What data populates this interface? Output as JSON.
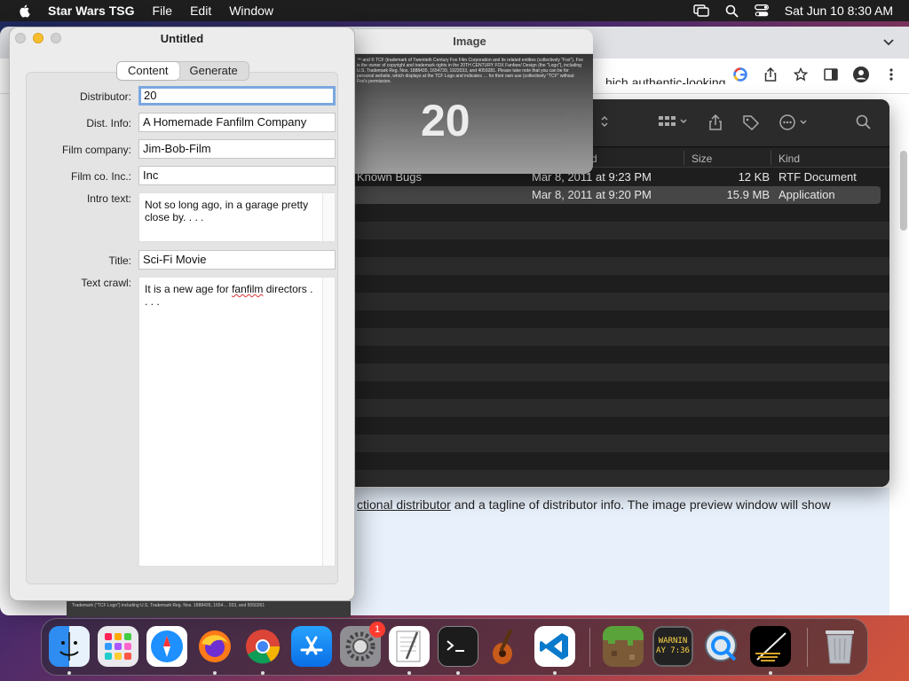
{
  "menubar": {
    "app_name": "Star Wars TSG",
    "menus": [
      "File",
      "Edit",
      "Window"
    ],
    "clock": "Sat Jun 10   8:30 AM"
  },
  "browser": {
    "top_text": "…hich authentic-looking.",
    "body_link": "ctional distributor",
    "body_text": " and a tagline of distributor info. The image preview window will show"
  },
  "finder": {
    "columns": {
      "date": "d",
      "size": "Size",
      "kind": "Kind"
    },
    "rows": [
      {
        "name": "Known Bugs",
        "date": "Mar 8, 2011 at 9:23 PM",
        "size": "12 KB",
        "kind": "RTF Document"
      },
      {
        "name": "",
        "date": "Mar 8, 2011 at 9:20 PM",
        "size": "15.9 MB",
        "kind": "Application"
      }
    ]
  },
  "image_window": {
    "title": "Image",
    "fine_print": "™ and © TCF (trademark of Twentieth Century Fox Film Corporation and its related entities (collectively \"Fox\"). Fox is the owner of copyright and trademark rights in the 20TH CENTURY FOX Fanfare/ Design (the \"Logo\"), including U.S. Trademark Reg. Nos. 1888435, 1654739, 1922033, and 4059281. Please take note that you can be for personal website, which displays at the TCF Logo and indicates … for their own use (collectively \"TCF\" without Fox's permission.",
    "big": "20"
  },
  "main_window": {
    "title": "Untitled",
    "tabs": [
      "Content",
      "Generate"
    ],
    "fields": {
      "distributor_label": "Distributor:",
      "distributor": "20",
      "dist_info_label": "Dist. Info:",
      "dist_info": "A Homemade Fanfilm Company",
      "film_company_label": "Film company:",
      "film_company": "Jim-Bob-Film",
      "film_inc_label": "Film co. Inc.:",
      "film_inc": "Inc",
      "intro_label": "Intro text:",
      "intro": "Not so long ago, in a garage pretty close by. . . .",
      "title_label": "Title:",
      "title": "Sci-Fi Movie",
      "crawl_label": "Text crawl:",
      "crawl_a": "It is a new age for ",
      "crawl_b": "fanfilm",
      "crawl_c": " directors . . . ."
    }
  },
  "desk_snippet": "Trademark (\"TCF Logo\") including U.S. Trademark Reg. Nos. 1888435, 1654… 033, and 5550261",
  "dock": {
    "settings_badge": "1",
    "console_text_1": "WARNIN",
    "console_text_2": "AY 7:36",
    "apps": [
      "Finder",
      "Launchpad",
      "Safari",
      "Firefox",
      "Chrome",
      "App Store",
      "System Settings",
      "TextEdit",
      "Terminal",
      "GarageBand",
      "Visual Studio Code",
      "Minecraft",
      "Console",
      "QuickTime Player",
      "Star Wars TSG",
      "Trash"
    ]
  }
}
